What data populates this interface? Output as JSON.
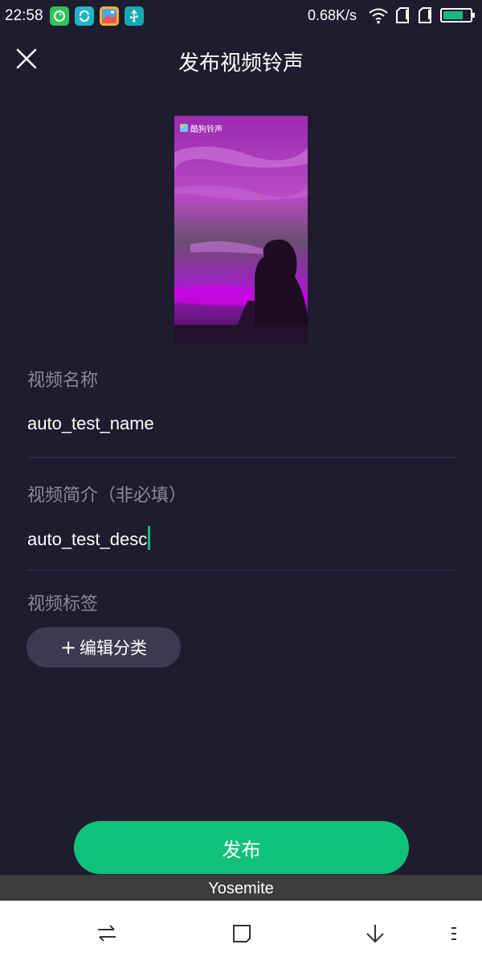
{
  "status_bar": {
    "time": "22:58",
    "net_speed": "0.68K/s",
    "app_icons": [
      "refresh-app-icon",
      "sync-app-icon",
      "gallery-app-icon",
      "usb-icon"
    ],
    "battery_color": "#16b982"
  },
  "header": {
    "title": "发布视频铃声",
    "close_icon": "close-icon"
  },
  "preview": {
    "watermark": "酷狗铃声"
  },
  "form": {
    "name_label": "视频名称",
    "name_value": "auto_test_name",
    "desc_label": "视频简介（非必填）",
    "desc_value": "auto_test_desc",
    "tag_label": "视频标签",
    "tag_button_plus": "+",
    "tag_button_text": "编辑分类"
  },
  "publish_button": "发布",
  "overlay_label": "Yosemite",
  "nav_icons": [
    "switch-icon",
    "square-icon",
    "download-icon",
    "menu-icon"
  ],
  "colors": {
    "background": "#1e1c2f",
    "accent": "#10c17b",
    "tag_button_bg": "#3c3a4e",
    "label_text": "#8a8898"
  }
}
